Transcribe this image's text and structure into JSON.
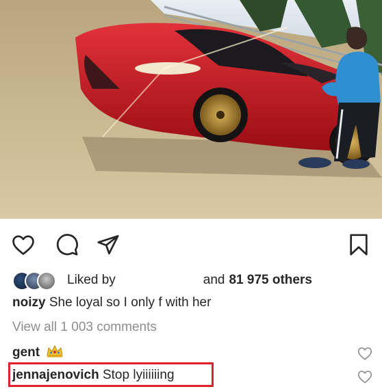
{
  "post": {
    "likes": {
      "liked_by_label": "Liked by",
      "others_prefix": "and",
      "others_count": "81 975 others"
    },
    "caption": {
      "username": "noizy",
      "text": "She loyal so I only f with her"
    },
    "view_all_comments": "View all 1 003 comments",
    "comments": [
      {
        "username": "gent",
        "text": "",
        "emoji": "crown"
      },
      {
        "username": "jennajenovich",
        "text": "Stop lyiiiiiing"
      }
    ]
  },
  "icons": {
    "like": "heart-icon",
    "comment": "comment-bubble-icon",
    "share": "paper-plane-icon",
    "save": "bookmark-icon",
    "comment_like": "heart-icon"
  },
  "colors": {
    "text": "#262626",
    "muted": "#8e8e8e",
    "highlight_box": "#e0202a",
    "car": "#c2141c"
  }
}
